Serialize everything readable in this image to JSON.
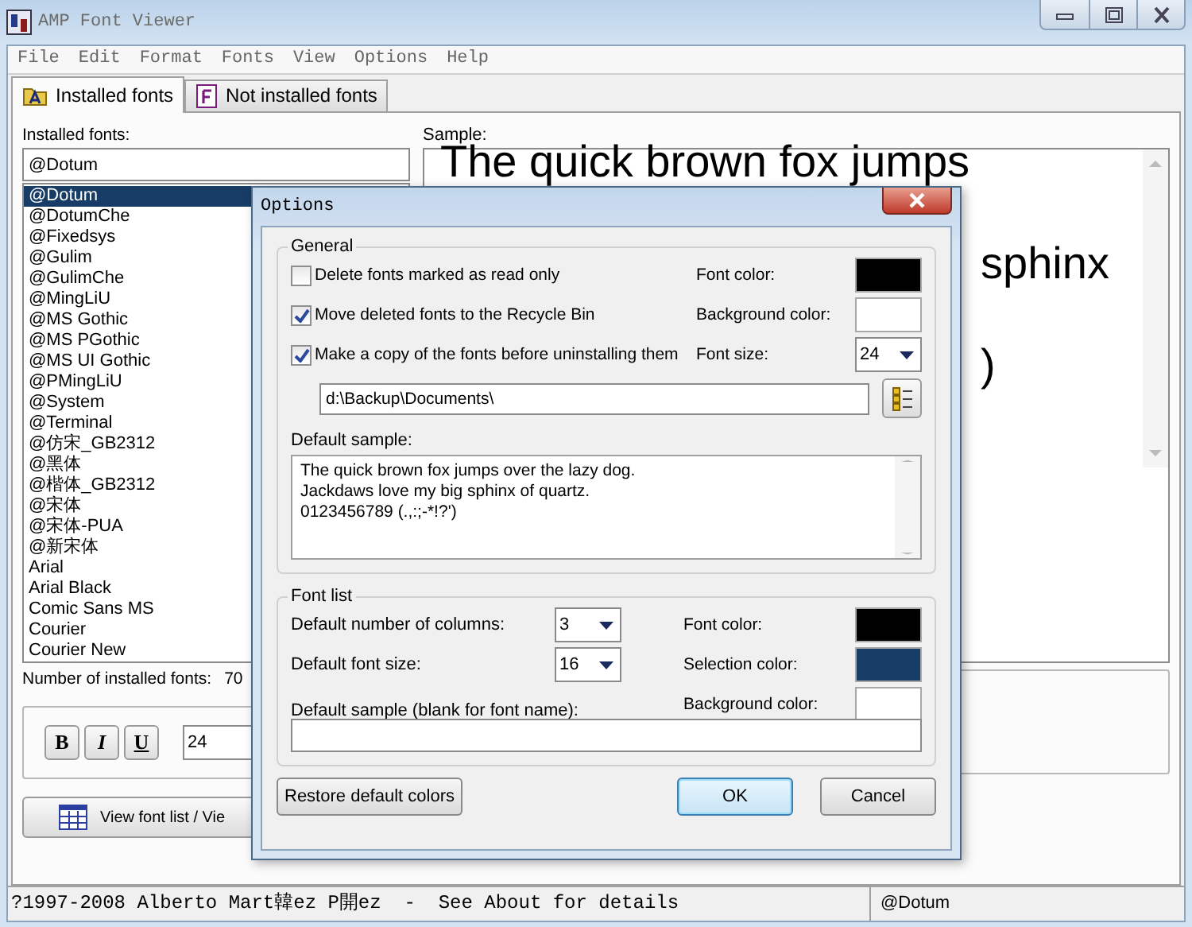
{
  "window": {
    "title": "AMP Font Viewer"
  },
  "menu": [
    "File",
    "Edit",
    "Format",
    "Fonts",
    "View",
    "Options",
    "Help"
  ],
  "tabs": [
    {
      "label": "Installed fonts",
      "selected": true
    },
    {
      "label": "Not installed fonts",
      "selected": false
    }
  ],
  "installed": {
    "label": "Installed fonts:",
    "search_value": "@Dotum",
    "fonts": [
      {
        "name": "@Dotum",
        "selected": true
      },
      {
        "name": "@DotumChe",
        "selected": false
      },
      {
        "name": "@Fixedsys",
        "selected": false
      },
      {
        "name": "@Gulim",
        "selected": false
      },
      {
        "name": "@GulimChe",
        "selected": false
      },
      {
        "name": "@MingLiU",
        "selected": false
      },
      {
        "name": "@MS Gothic",
        "selected": false
      },
      {
        "name": "@MS PGothic",
        "selected": false
      },
      {
        "name": "@MS UI Gothic",
        "selected": false
      },
      {
        "name": "@PMingLiU",
        "selected": false
      },
      {
        "name": "@System",
        "selected": false
      },
      {
        "name": "@Terminal",
        "selected": false
      },
      {
        "name": "@仿宋_GB2312",
        "selected": false
      },
      {
        "name": "@黑体",
        "selected": false
      },
      {
        "name": "@楷体_GB2312",
        "selected": false
      },
      {
        "name": "@宋体",
        "selected": false
      },
      {
        "name": "@宋体-PUA",
        "selected": false
      },
      {
        "name": "@新宋体",
        "selected": false
      },
      {
        "name": "Arial",
        "selected": false
      },
      {
        "name": "Arial Black",
        "selected": false
      },
      {
        "name": "Comic Sans MS",
        "selected": false
      },
      {
        "name": "Courier",
        "selected": false
      },
      {
        "name": "Courier New",
        "selected": false
      }
    ],
    "count_label": "Number of installed fonts:",
    "count": "70"
  },
  "format": {
    "bold": "B",
    "italic": "I",
    "underline": "U",
    "size": "24"
  },
  "view_button": "View font list / Vie",
  "sample": {
    "label": "Sample:",
    "lines": [
      {
        "text": "The quick brown fox jumps",
        "kind": "full"
      },
      {
        "text": "sphinx",
        "kind": "tail"
      },
      {
        "text": ")",
        "kind": "tail"
      }
    ]
  },
  "status_bar": {
    "text": "?1997-2008 Alberto Mart韓ez P開ez  -  See About for details",
    "font": "@Dotum"
  },
  "dialog": {
    "title": "Options",
    "general": {
      "legend": "General",
      "options": [
        {
          "label": "Delete fonts marked as read only",
          "checked": false
        },
        {
          "label": "Move deleted fonts to the Recycle Bin",
          "checked": true
        },
        {
          "label": "Make a copy of the fonts before uninstalling them",
          "checked": true
        }
      ],
      "colors": [
        {
          "label": "Font color:",
          "color": "#000000"
        },
        {
          "label": "Background color:",
          "color": "#ffffff"
        }
      ],
      "font_size_label": "Font size:",
      "font_size": "24",
      "path": "d:\\Backup\\Documents\\",
      "sample_label": "Default sample:",
      "sample_lines": [
        "The quick brown fox jumps over the lazy dog.",
        "Jackdaws love my big sphinx of quartz.",
        "0123456789 (.,:;-*!?')"
      ]
    },
    "font_list": {
      "legend": "Font list",
      "columns_label": "Default number of columns:",
      "columns": "3",
      "size_label": "Default font size:",
      "size": "16",
      "sample_label": "Default sample (blank for font name):",
      "colors": [
        {
          "label": "Font color:",
          "color": "#000000"
        },
        {
          "label": "Selection color:",
          "color": "#173d66"
        },
        {
          "label": "Background color:",
          "color": "#ffffff"
        }
      ]
    },
    "buttons": [
      {
        "label": "Restore default colors",
        "kind": "left"
      },
      {
        "label": "OK",
        "kind": "default"
      },
      {
        "label": "Cancel",
        "kind": "normal"
      }
    ]
  }
}
